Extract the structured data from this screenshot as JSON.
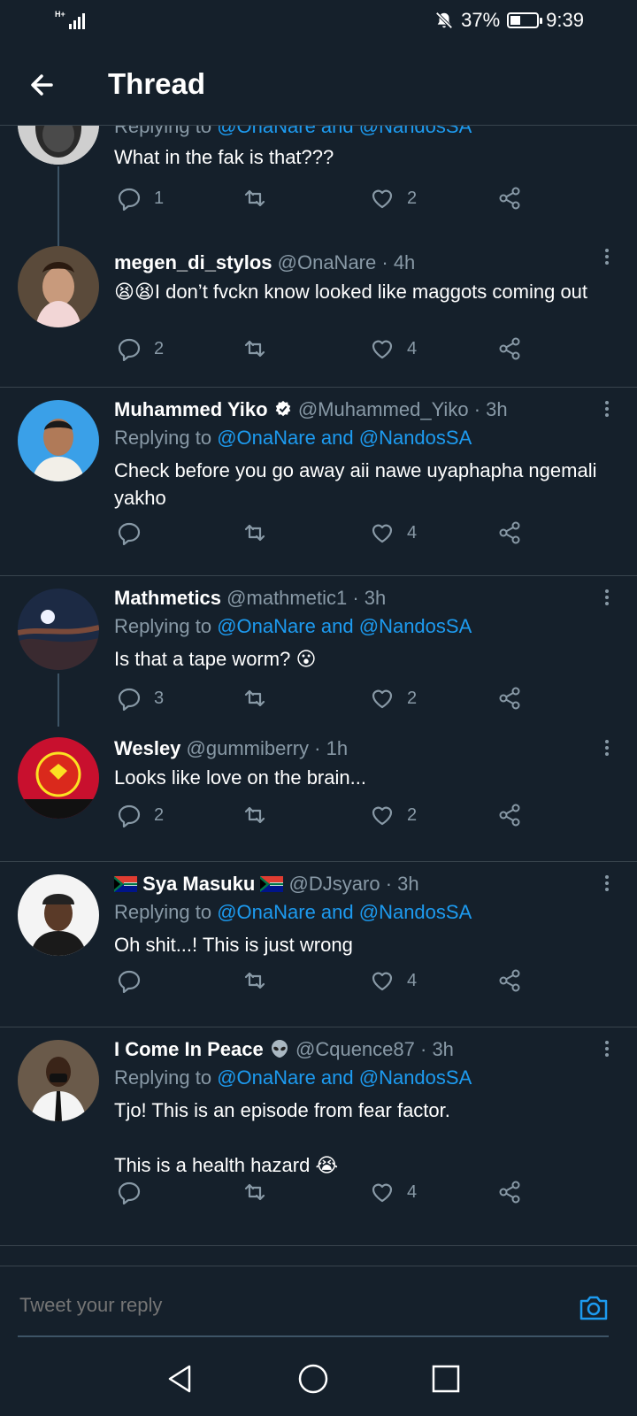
{
  "status": {
    "network": "H+",
    "battery": "37%",
    "battery_level": 0.37,
    "time": "9:39"
  },
  "header": {
    "title": "Thread"
  },
  "tweets": [
    {
      "reply_to_prefix": "Replying to",
      "reply_to_targets": "@OnaNare and @NandosSA",
      "text": "What in the fak is that???",
      "replies": "1",
      "retweets": "",
      "likes": "2"
    },
    {
      "name": "megen_di_stylos",
      "handle": "@OnaNare",
      "time": "· 4h",
      "emoji": "😫😫",
      "text": "I don’t fvckn know looked like maggots coming out",
      "replies": "2",
      "retweets": "",
      "likes": "4"
    },
    {
      "name": "Muhammed Yiko",
      "verified_icon": "verified-badge-icon",
      "handle": "@Muhammed_Yiko",
      "time": "· 3h",
      "reply_to_prefix": "Replying to",
      "reply_to_targets": "@OnaNare and @NandosSA",
      "text": "Check before you go away aii nawe uyaphapha ngemali yakho",
      "replies": "",
      "retweets": "",
      "likes": "4"
    },
    {
      "name": "Mathmetics",
      "handle": "@mathmetic1",
      "time": "· 3h",
      "reply_to_prefix": "Replying to",
      "reply_to_targets": "@OnaNare and @NandosSA",
      "text": "Is that a tape worm?",
      "emoji": "😮",
      "replies": "3",
      "retweets": "",
      "likes": "2"
    },
    {
      "name": "Wesley",
      "handle": "@gummiberry",
      "time": "· 1h",
      "text": "Looks like love on the brain...",
      "replies": "2",
      "retweets": "",
      "likes": "2"
    },
    {
      "name": "Sya Masuku",
      "flag_icon": "south-africa-flag-icon",
      "handle": "@DJsyaro",
      "time": "· 3h",
      "reply_to_prefix": "Replying to",
      "reply_to_targets": "@OnaNare and @NandosSA",
      "text": "Oh shit...! This is just wrong",
      "replies": "",
      "retweets": "",
      "likes": "4"
    },
    {
      "name": "I Come In Peace",
      "name_icon": "alien-icon",
      "handle": "@Cquence87",
      "time": "· 3h",
      "reply_to_prefix": "Replying to",
      "reply_to_targets": "@OnaNare and @NandosSA",
      "text": "Tjo! This is an episode from fear factor.\n\nThis is a health hazard",
      "emoji": "😭",
      "replies": "",
      "retweets": "",
      "likes": "4"
    }
  ],
  "reply_box": {
    "placeholder": "Tweet your reply"
  },
  "colors": {
    "background": "#15202b",
    "accent": "#1d9bf0",
    "muted": "#8899a6",
    "divider": "#38444d"
  }
}
